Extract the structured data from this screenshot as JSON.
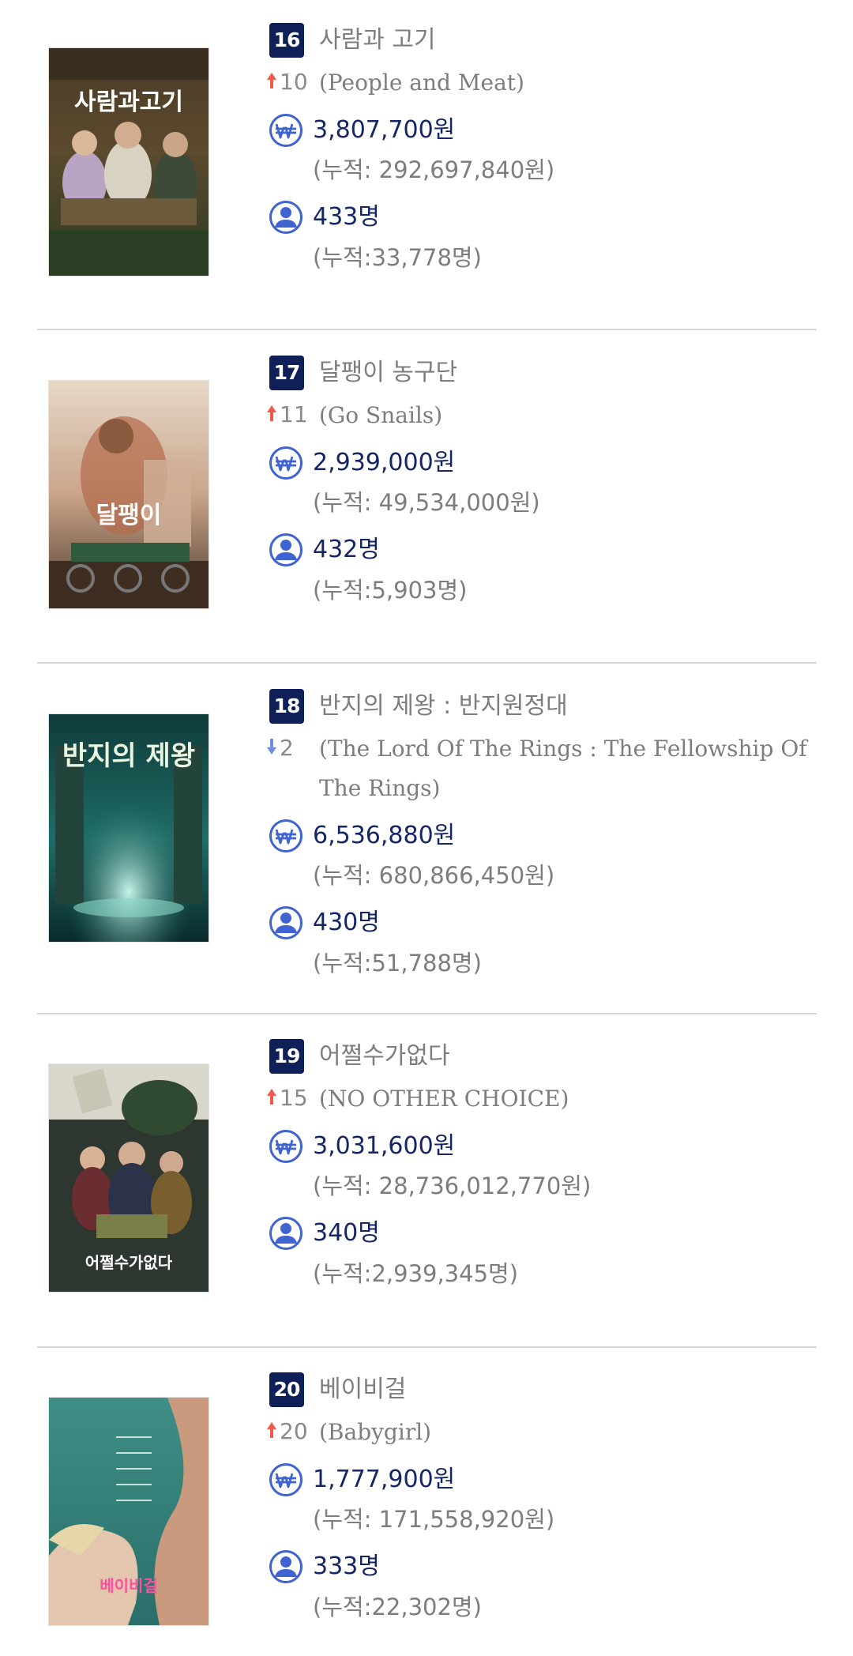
{
  "colors": {
    "rank_badge_bg": "#0f1f57",
    "value_text": "#152665",
    "secondary_text": "#7d7d7d",
    "icon_accent": "#3f64d2",
    "arrow_up": "#f05a4a",
    "arrow_down": "#6f8fe0",
    "divider": "#d7d7d7"
  },
  "icons": {
    "revenue": "won-currency-icon",
    "audience": "person-icon",
    "up": "arrow-up-icon",
    "down": "arrow-down-icon"
  },
  "movies": [
    {
      "rank": "16",
      "title_ko": "사람과 고기",
      "rank_change": "10",
      "change_direction": "up",
      "title_en": "(People and Meat)",
      "daily_revenue": "3,807,700원",
      "total_revenue": "(누적: 292,697,840원)",
      "daily_audience": "433명",
      "total_audience": "(누적:33,778명)",
      "poster_text": "사람과고기"
    },
    {
      "rank": "17",
      "title_ko": "달팽이 농구단",
      "rank_change": "11",
      "change_direction": "up",
      "title_en": "(Go Snails)",
      "daily_revenue": "2,939,000원",
      "total_revenue": "(누적: 49,534,000원)",
      "daily_audience": "432명",
      "total_audience": "(누적:5,903명)",
      "poster_text": "달팽이"
    },
    {
      "rank": "18",
      "title_ko": "반지의 제왕 : 반지원정대",
      "rank_change": "2",
      "change_direction": "down",
      "title_en": "(The Lord Of The Rings : The Fellowship Of The Rings)",
      "daily_revenue": "6,536,880원",
      "total_revenue": "(누적: 680,866,450원)",
      "daily_audience": "430명",
      "total_audience": "(누적:51,788명)",
      "poster_text": "반지의 제왕"
    },
    {
      "rank": "19",
      "title_ko": "어쩔수가없다",
      "rank_change": "15",
      "change_direction": "up",
      "title_en": "(NO OTHER CHOICE)",
      "daily_revenue": "3,031,600원",
      "total_revenue": "(누적: 28,736,012,770원)",
      "daily_audience": "340명",
      "total_audience": "(누적:2,939,345명)",
      "poster_text": "어쩔수가없다"
    },
    {
      "rank": "20",
      "title_ko": "베이비걸",
      "rank_change": "20",
      "change_direction": "up",
      "title_en": "(Babygirl)",
      "daily_revenue": "1,777,900원",
      "total_revenue": "(누적: 171,558,920원)",
      "daily_audience": "333명",
      "total_audience": "(누적:22,302명)",
      "poster_text": "베이비걸"
    }
  ]
}
